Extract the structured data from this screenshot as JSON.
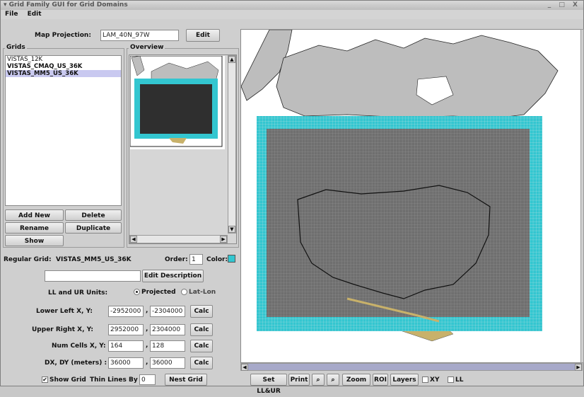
{
  "window": {
    "title": "Grid Family GUI for Grid Domains",
    "controls": "_ □ X"
  },
  "menu": {
    "file": "File",
    "edit": "Edit"
  },
  "projection": {
    "label": "Map Projection:",
    "value": "LAM_40N_97W",
    "edit_button": "Edit"
  },
  "grids": {
    "title": "Grids",
    "items": [
      "VISTAS_12K",
      "VISTAS_CMAQ_US_36K",
      "VISTAS_MM5_US_36K"
    ],
    "selected_index": 2,
    "add_new": "Add New",
    "delete": "Delete",
    "rename": "Rename",
    "duplicate": "Duplicate",
    "show": "Show"
  },
  "overview": {
    "title": "Overview"
  },
  "regular_grid": {
    "label": "Regular Grid:",
    "name": "VISTAS_MM5_US_36K",
    "order_label": "Order:",
    "order_value": "1",
    "color_label": "Color:",
    "color": "#33c6d0",
    "description_value": "",
    "edit_description": "Edit Description",
    "units_label": "LL and UR Units:",
    "units_projected": "Projected",
    "units_latlon": "Lat-Lon",
    "units_selected": "Projected",
    "lower_left_label": "Lower Left X, Y:",
    "lower_left_x": "-2952000",
    "lower_left_y": "-2304000",
    "upper_right_label": "Upper Right X, Y:",
    "upper_right_x": "2952000",
    "upper_right_y": "2304000",
    "num_cells_label": "Num Cells X, Y:",
    "num_cells_x": "164",
    "num_cells_y": "128",
    "dxdy_label": "DX, DY (meters) :",
    "dx": "36000",
    "dy": "36000",
    "calc": "Calc",
    "comma": ",",
    "show_grid": "Show Grid",
    "show_grid_checked": true,
    "thin_lines_label": "Thin Lines By",
    "thin_lines_value": "0",
    "nest_grid": "Nest Grid"
  },
  "map_toolbar": {
    "set_llur": "Set LL&UR",
    "print": "Print",
    "zoom_in_icon": "zoom-in-icon",
    "zoom_out_icon": "zoom-out-icon",
    "zoom": "Zoom",
    "roi": "ROI",
    "layers": "Layers",
    "xy": "XY",
    "ll": "LL"
  },
  "colors": {
    "accent": "#33c6d0",
    "land": "#bdbdbd",
    "grid": "#6f6f6f",
    "mexico": "#c8b16a"
  }
}
